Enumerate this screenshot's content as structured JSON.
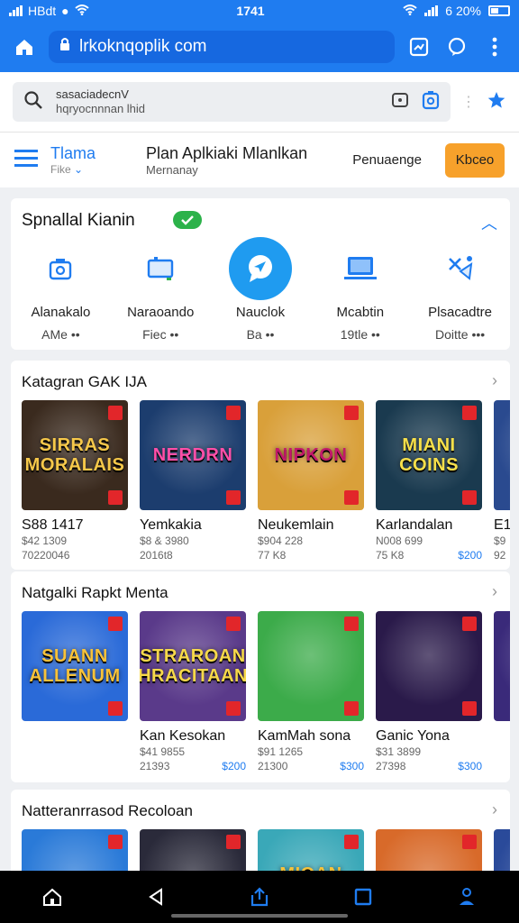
{
  "status_bar": {
    "carrier": "HBdt",
    "time": "1741",
    "battery": "6 20%"
  },
  "browser": {
    "url": "lrkoknqoplik com"
  },
  "search": {
    "line1": "sasaciadecnV",
    "line2": "hqryocnnnan lhid"
  },
  "header": {
    "brand_name": "Tlama",
    "brand_sub": "Fike",
    "title": "Plan Aplkiaki Mlanlkan",
    "subtitle": "Mernanay",
    "link": "Penuaenge",
    "button": "Kbceo"
  },
  "categories": {
    "title": "Spnallal Kianin",
    "items": [
      {
        "label": "Alanakalo",
        "sub": "AMe ••",
        "icon": "camera-icon"
      },
      {
        "label": "Naraoando",
        "sub": "Fiec ••",
        "icon": "screen-icon"
      },
      {
        "label": "Nauclok",
        "sub": "Ba ••",
        "icon": "chat-bubble-icon"
      },
      {
        "label": "Mcabtin",
        "sub": "19tle ••",
        "icon": "laptop-icon"
      },
      {
        "label": "Plsacadtre",
        "sub": "Doitte •••",
        "icon": "tools-icon"
      }
    ]
  },
  "sections": [
    {
      "title": "Katagran GAK IJA",
      "tiles": [
        {
          "art": "SIRRAS MORALAIS",
          "title": "S88 1417",
          "meta1": "$42 1309",
          "meta2": "70220046",
          "price": "",
          "bg": "#3a2a1e",
          "art_color": "#f6c84a"
        },
        {
          "art": "NERDRN",
          "title": "Yemkakia",
          "meta1": "$8 & 3980",
          "meta2": "2016t8",
          "price": "",
          "bg": "#1c3d6e",
          "art_color": "#ff4fa8"
        },
        {
          "art": "NIPKON",
          "title": "Neukemlain",
          "meta1": "$904 228",
          "meta2": "77 K8",
          "price": "",
          "bg": "#d9a03a",
          "art_color": "#c2186b"
        },
        {
          "art": "MIANI COINS",
          "title": "Karlandalan",
          "meta1": "N008 699",
          "meta2": "75 K8",
          "price": "$200",
          "bg": "#1a3a4f",
          "art_color": "#f7e04a"
        },
        {
          "art": "",
          "title": "E1",
          "meta1": "$9",
          "meta2": "92",
          "price": "",
          "bg": "#2a4a8f",
          "art_color": "#ffffff"
        }
      ]
    },
    {
      "title": "Natgalki Rapkt Menta",
      "tiles": [
        {
          "art": "SUANN ALLENUM",
          "title": "",
          "meta1": "",
          "meta2": "",
          "price": "",
          "bg": "#2a6ad8",
          "art_color": "#f7c23a"
        },
        {
          "art": "STRAROAN HRACITAAN",
          "title": "Kan Kesokan",
          "meta1": "$41 9855",
          "meta2": "21393",
          "price": "$200",
          "bg": "#5a3a8a",
          "art_color": "#f7d94a"
        },
        {
          "art": "",
          "title": "KamMah sona",
          "meta1": "$91 1265",
          "meta2": "21300",
          "price": "$300",
          "bg": "#3cab4a",
          "art_color": "#ffffff"
        },
        {
          "art": "",
          "title": "Ganic Yona",
          "meta1": "$31 3899",
          "meta2": "27398",
          "price": "$300",
          "bg": "#2a1a4a",
          "art_color": "#ffffff"
        },
        {
          "art": "",
          "title": "",
          "meta1": "",
          "meta2": "",
          "price": "",
          "bg": "#3a2a7a",
          "art_color": "#ffffff"
        }
      ]
    },
    {
      "title": "Natteranrrasod Recoloan",
      "tiles": [
        {
          "art": "",
          "title": "",
          "meta1": "",
          "meta2": "",
          "price": "",
          "bg": "#2a7ad8",
          "art_color": "#ffffff"
        },
        {
          "art": "",
          "title": "",
          "meta1": "",
          "meta2": "",
          "price": "",
          "bg": "#2a2a3a",
          "art_color": "#ffffff"
        },
        {
          "art": "MIOAN MEREEN",
          "title": "",
          "meta1": "",
          "meta2": "",
          "price": "",
          "bg": "#3aa8b8",
          "art_color": "#f7c23a"
        },
        {
          "art": "",
          "title": "",
          "meta1": "",
          "meta2": "",
          "price": "",
          "bg": "#d86a2a",
          "art_color": "#ffffff"
        },
        {
          "art": "",
          "title": "",
          "meta1": "",
          "meta2": "",
          "price": "",
          "bg": "#2a4a9a",
          "art_color": "#ffffff"
        }
      ]
    }
  ],
  "colors": {
    "accent": "#1f7cf0",
    "cta": "#f7a12b",
    "check": "#2cb24a"
  }
}
